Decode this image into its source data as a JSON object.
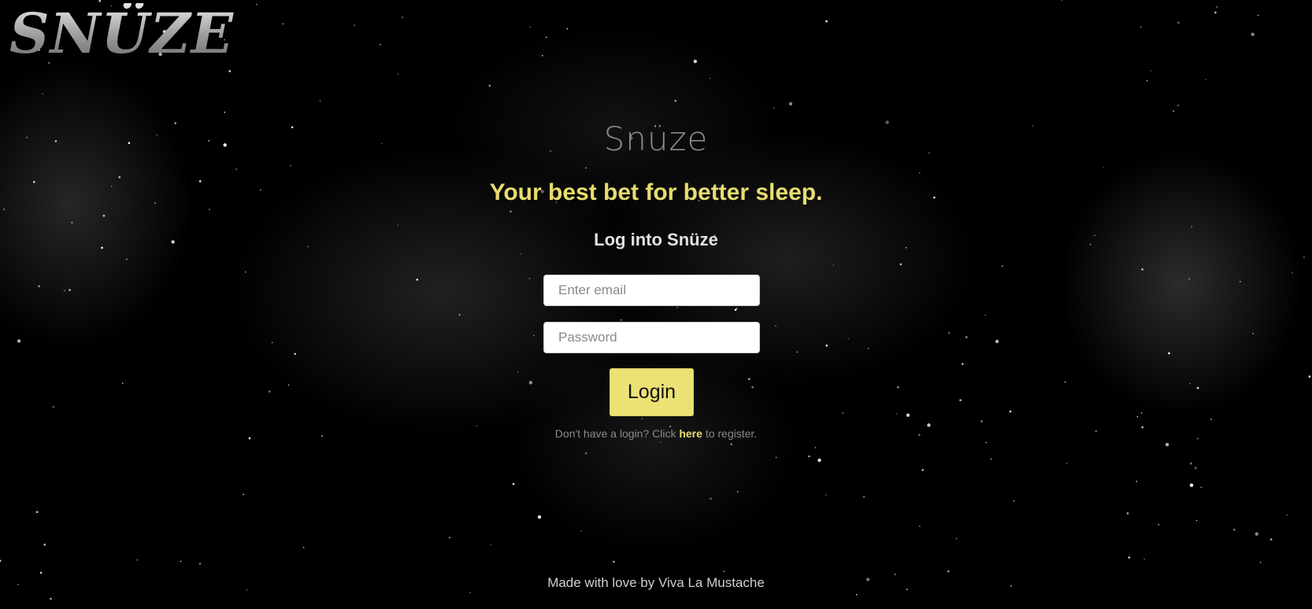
{
  "brand": {
    "logo_text": "SNÜZE",
    "site_title": "Snüze",
    "tagline": "Your best bet for better sleep."
  },
  "login": {
    "heading": "Log into Snüze",
    "email_placeholder": "Enter email",
    "password_placeholder": "Password",
    "button_label": "Login",
    "register_prefix": "Don't have a login? Click",
    "register_link": "here",
    "register_suffix": "to register."
  },
  "footer": {
    "credit": "Made with love by Viva La Mustache"
  },
  "colors": {
    "background": "#000000",
    "accent_yellow": "#ece174",
    "tagline_yellow": "#e8dc6e",
    "muted_gray": "#8a8a8a"
  }
}
